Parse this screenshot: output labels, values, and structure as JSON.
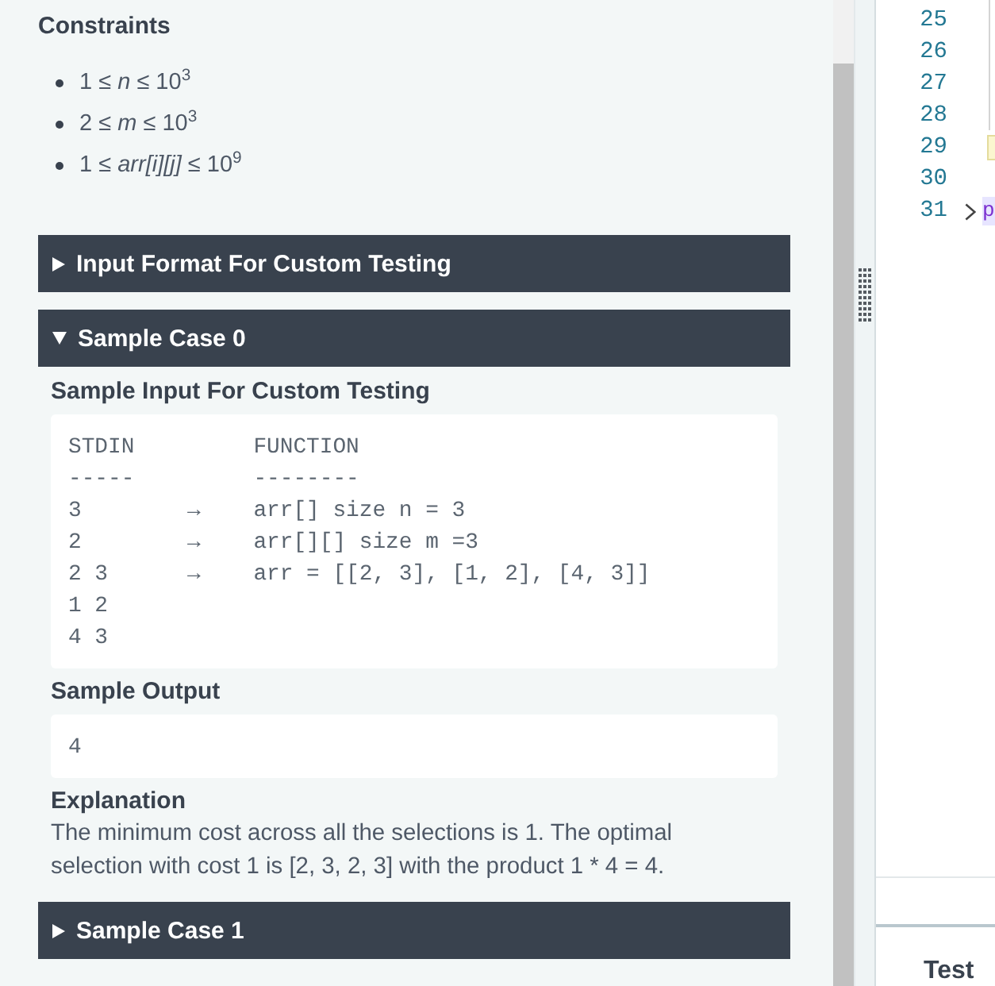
{
  "problem": {
    "constraints": {
      "heading": "Constraints",
      "items": [
        "1 ≤ *n* ≤ 10$^{3}$",
        "2 ≤ *m* ≤ 10$^{3}$",
        "1 ≤ *arr[i][j]* ≤ 10$^{9}$"
      ]
    },
    "sections": [
      {
        "title": "Input Format For Custom Testing",
        "expanded": false
      },
      {
        "title": "Sample Case 0",
        "expanded": true,
        "blocks": [
          {
            "kind": "code",
            "heading": "Sample Input For Custom Testing",
            "lines": [
              "STDIN         FUNCTION",
              "-----         --------",
              "3        →    arr[] size n = 3",
              "2        →    arr[][] size m =3",
              "2 3      →    arr = [[2, 3], [1, 2], [4, 3]]",
              "1 2",
              "4 3"
            ]
          },
          {
            "kind": "code",
            "heading": "Sample Output",
            "lines": [
              "4"
            ]
          },
          {
            "kind": "text",
            "heading": "Explanation",
            "text": "The minimum cost across all the selections is 1. The optimal selection with cost 1 is [2, 3, 2, 3] with the product 1 * 4 = 4."
          }
        ]
      },
      {
        "title": "Sample Case 1",
        "expanded": false
      }
    ]
  },
  "editor": {
    "lines": [
      {
        "number": "25",
        "folded": false,
        "bracket_match": false
      },
      {
        "number": "26",
        "folded": false,
        "bracket_match": false
      },
      {
        "number": "27",
        "folded": false,
        "bracket_match": false
      },
      {
        "number": "28",
        "folded": false,
        "bracket_match": false
      },
      {
        "number": "29",
        "folded": false,
        "bracket_match": true
      },
      {
        "number": "30",
        "folded": false,
        "bracket_match": false
      },
      {
        "number": "31",
        "folded": true,
        "bracket_match": false,
        "code": "p"
      }
    ]
  },
  "bottom_panel": {
    "title": "Test"
  }
}
